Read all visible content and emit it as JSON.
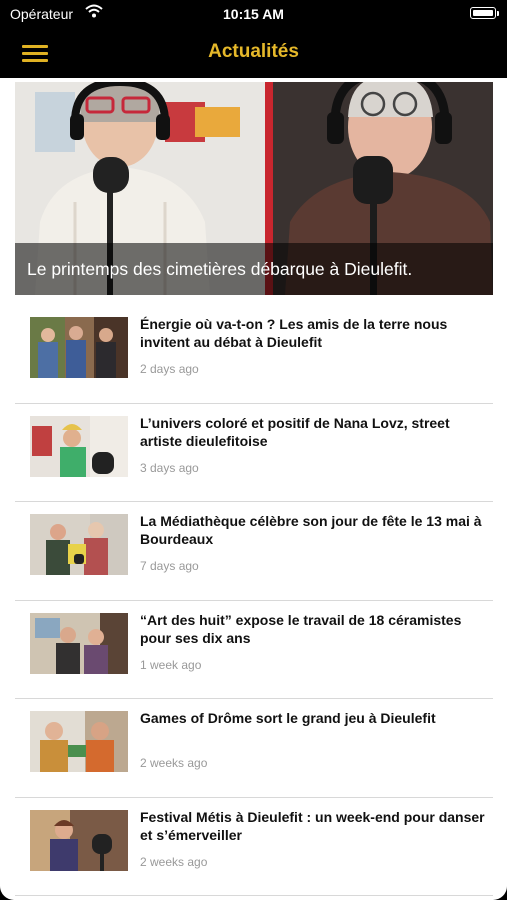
{
  "status": {
    "carrier": "Opérateur",
    "time": "10:15 AM"
  },
  "nav": {
    "title": "Actualités",
    "menu_icon": "hamburger-menu-icon",
    "accent": "#e5b82a"
  },
  "hero": {
    "caption": "Le printemps des cimetières débarque à Dieulefit."
  },
  "articles": [
    {
      "title": "Énergie où va-t-on ? Les amis de la terre nous invitent au débat à Dieulefit",
      "time": "2 days ago"
    },
    {
      "title": "L’univers coloré et positif de Nana Lovz, street artiste dieulefitoise",
      "time": "3 days ago"
    },
    {
      "title": "La Médiathèque célèbre son jour de fête le 13 mai à Bourdeaux",
      "time": "7 days ago"
    },
    {
      "title": "“Art des huit” expose le travail de 18 céramistes pour ses dix ans",
      "time": "1 week ago"
    },
    {
      "title": "Games of Drôme sort le grand jeu à Dieulefit",
      "time": "2 weeks ago"
    },
    {
      "title": "Festival Métis à Dieulefit : un week-end pour danser et s’émerveiller",
      "time": "2 weeks ago"
    }
  ]
}
